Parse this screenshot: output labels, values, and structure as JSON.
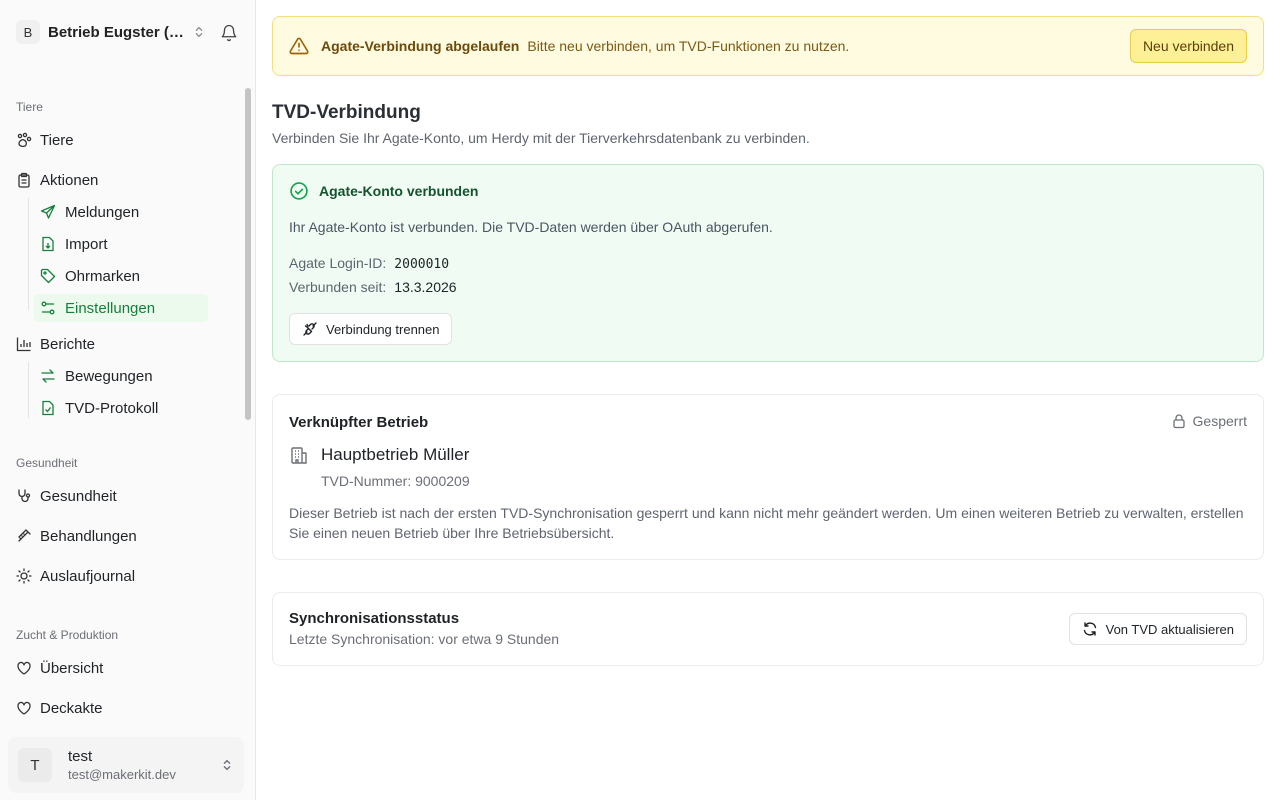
{
  "sidebar": {
    "org": {
      "initial": "B",
      "name": "Betrieb Eugster (H..."
    },
    "sections": [
      {
        "label": "Tiere"
      },
      {
        "label": "Gesundheit"
      },
      {
        "label": "Zucht & Produktion"
      }
    ],
    "items": {
      "tiere": "Tiere",
      "aktionen": "Aktionen",
      "meldungen": "Meldungen",
      "import": "Import",
      "ohrmarken": "Ohrmarken",
      "einstellungen": "Einstellungen",
      "berichte": "Berichte",
      "bewegungen": "Bewegungen",
      "tvd_protokoll": "TVD-Protokoll",
      "gesundheit": "Gesundheit",
      "behandlungen": "Behandlungen",
      "auslaufjournal": "Auslaufjournal",
      "uebersicht": "Übersicht",
      "deckakte": "Deckakte"
    },
    "user": {
      "initial": "T",
      "name": "test",
      "email": "test@makerkit.dev"
    }
  },
  "alert": {
    "title": "Agate-Verbindung abgelaufen",
    "description": "Bitte neu verbinden, um TVD-Funktionen zu nutzen.",
    "button": "Neu verbinden"
  },
  "page": {
    "title": "TVD-Verbindung",
    "description": "Verbinden Sie Ihr Agate-Konto, um Herdy mit der Tierverkehrsdatenbank zu verbinden."
  },
  "connection": {
    "title": "Agate-Konto verbunden",
    "description": "Ihr Agate-Konto ist verbunden. Die TVD-Daten werden über OAuth abgerufen.",
    "login_label": "Agate Login-ID:",
    "login_value": "2000010",
    "since_label": "Verbunden seit:",
    "since_value": "13.3.2026",
    "disconnect_button": "Verbindung trennen"
  },
  "linked_farm": {
    "title": "Verknüpfter Betrieb",
    "locked_label": "Gesperrt",
    "farm_name": "Hauptbetrieb Müller",
    "tvd_number": "TVD-Nummer: 9000209",
    "note": "Dieser Betrieb ist nach der ersten TVD-Synchronisation gesperrt und kann nicht mehr geändert werden. Um einen weiteren Betrieb zu verwalten, erstellen Sie einen neuen Betrieb über Ihre Betriebsübersicht."
  },
  "sync": {
    "title": "Synchronisationsstatus",
    "last_sync": "Letzte Synchronisation: vor etwa 9 Stunden",
    "refresh_button": "Von TVD aktualisieren"
  },
  "colors": {
    "accent_green": "#15803d",
    "warning_bg": "#fefbe0",
    "success_bg": "#f0fcf3"
  }
}
